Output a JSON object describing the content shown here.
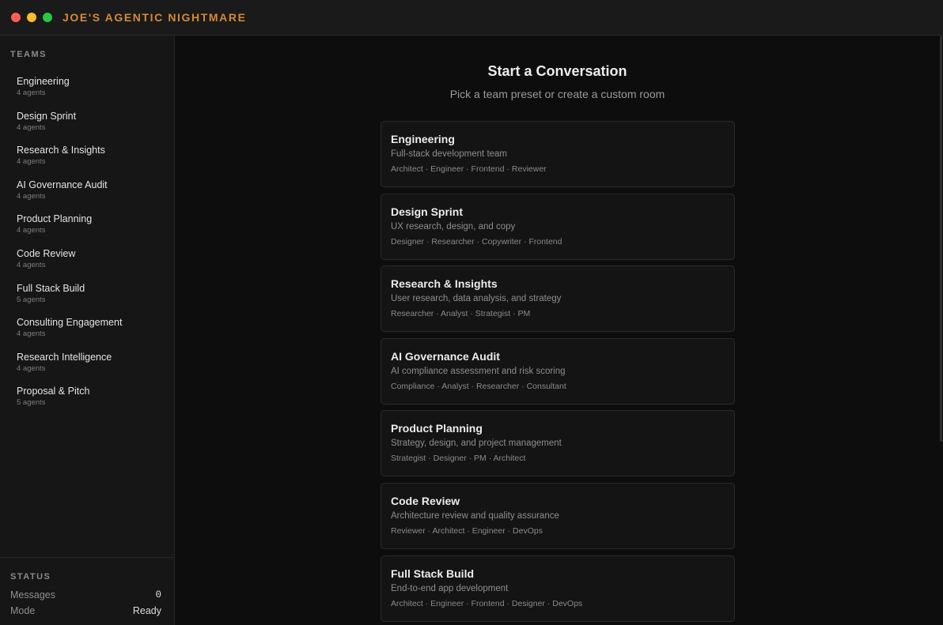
{
  "window": {
    "title": "JOE'S AGENTIC NIGHTMARE",
    "colors": {
      "accent": "#d4893a",
      "close": "#ff5f57",
      "minimize": "#febc2e",
      "maximize": "#28c840"
    }
  },
  "sidebar": {
    "teams_heading": "TEAMS",
    "teams": [
      {
        "name": "Engineering",
        "count": "4 agents"
      },
      {
        "name": "Design Sprint",
        "count": "4 agents"
      },
      {
        "name": "Research & Insights",
        "count": "4 agents"
      },
      {
        "name": "AI Governance Audit",
        "count": "4 agents"
      },
      {
        "name": "Product Planning",
        "count": "4 agents"
      },
      {
        "name": "Code Review",
        "count": "4 agents"
      },
      {
        "name": "Full Stack Build",
        "count": "5 agents"
      },
      {
        "name": "Consulting Engagement",
        "count": "4 agents"
      },
      {
        "name": "Research Intelligence",
        "count": "4 agents"
      },
      {
        "name": "Proposal & Pitch",
        "count": "5 agents"
      }
    ],
    "status": {
      "heading": "STATUS",
      "messages_label": "Messages",
      "messages_value": "0",
      "mode_label": "Mode",
      "mode_value": "Ready"
    }
  },
  "main": {
    "title": "Start a Conversation",
    "subtitle": "Pick a team preset or create a custom room",
    "cards": [
      {
        "title": "Engineering",
        "description": "Full-stack development team",
        "roles": "Architect · Engineer · Frontend · Reviewer"
      },
      {
        "title": "Design Sprint",
        "description": "UX research, design, and copy",
        "roles": "Designer · Researcher · Copywriter · Frontend"
      },
      {
        "title": "Research & Insights",
        "description": "User research, data analysis, and strategy",
        "roles": "Researcher · Analyst · Strategist · PM"
      },
      {
        "title": "AI Governance Audit",
        "description": "AI compliance assessment and risk scoring",
        "roles": "Compliance · Analyst · Researcher · Consultant"
      },
      {
        "title": "Product Planning",
        "description": "Strategy, design, and project management",
        "roles": "Strategist · Designer · PM · Architect"
      },
      {
        "title": "Code Review",
        "description": "Architecture review and quality assurance",
        "roles": "Reviewer · Architect · Engineer · DevOps"
      },
      {
        "title": "Full Stack Build",
        "description": "End-to-end app development",
        "roles": "Architect · Engineer · Frontend · Designer · DevOps"
      }
    ]
  }
}
